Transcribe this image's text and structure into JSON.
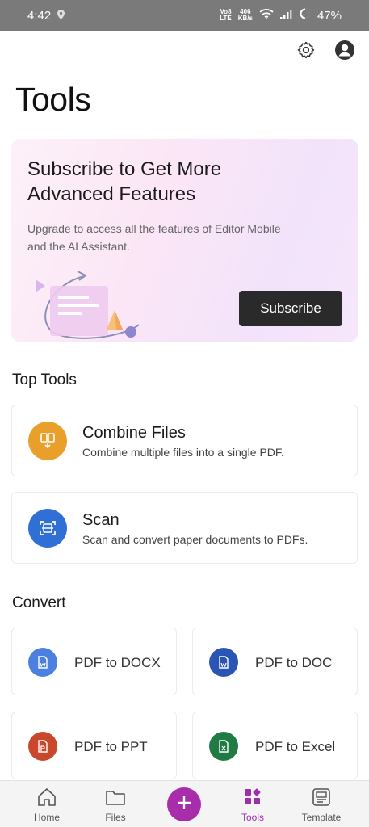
{
  "status_bar": {
    "time": "4:42",
    "network_top": "Vo8",
    "network_bottom": "LTE",
    "speed_top": "406",
    "speed_bottom": "KB/s",
    "battery": "47%"
  },
  "header": {
    "settings_icon": "gear-icon",
    "profile_icon": "account-circle-icon"
  },
  "page": {
    "title": "Tools"
  },
  "promo": {
    "title": "Subscribe to Get More Advanced Features",
    "description": "Upgrade to access all the features of Editor Mobile and the AI Assistant.",
    "button_label": "Subscribe"
  },
  "top_tools": {
    "heading": "Top Tools",
    "items": [
      {
        "title": "Combine Files",
        "description": "Combine multiple files into a single PDF.",
        "icon": "combine-files-icon",
        "color": "#e9a02a"
      },
      {
        "title": "Scan",
        "description": "Scan and convert paper documents to PDFs.",
        "icon": "scan-icon",
        "color": "#2f6fd6"
      }
    ]
  },
  "convert": {
    "heading": "Convert",
    "items": [
      {
        "label": "PDF to DOCX",
        "icon": "docx-icon",
        "color": "#4b7fe0"
      },
      {
        "label": "PDF to DOC",
        "icon": "doc-icon",
        "color": "#2a55b4"
      },
      {
        "label": "PDF to PPT",
        "icon": "ppt-icon",
        "color": "#c9472a"
      },
      {
        "label": "PDF to Excel",
        "icon": "excel-icon",
        "color": "#1f7a43"
      }
    ]
  },
  "bottom_nav": {
    "items": [
      {
        "label": "Home",
        "icon": "home-icon"
      },
      {
        "label": "Files",
        "icon": "folder-icon"
      },
      {
        "label": "Tools",
        "icon": "tools-grid-icon",
        "active": true
      },
      {
        "label": "Template",
        "icon": "template-icon"
      }
    ],
    "fab_icon": "plus-icon",
    "accent_color": "#a72dab"
  }
}
